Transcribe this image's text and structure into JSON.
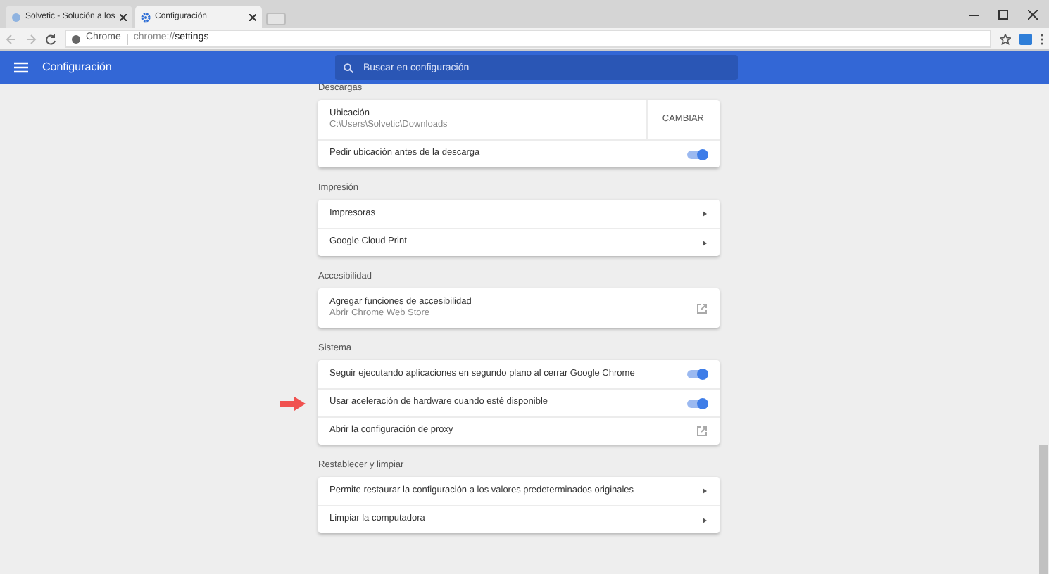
{
  "tabs": [
    {
      "label": "Solvetic - Solución a los",
      "selected": false
    },
    {
      "label": "Configuración",
      "selected": true
    }
  ],
  "address_bar": {
    "site": "Chrome",
    "url_prefix": "chrome://",
    "url_path": "settings"
  },
  "header": {
    "title": "Configuración",
    "search": {
      "placeholder": "Buscar en configuración"
    }
  },
  "sections": [
    {
      "title": "Descargas",
      "rows": [
        {
          "kind": "button",
          "label": "Ubicación",
          "secondary": "C:\\Users\\Solvetic\\Downloads",
          "action": "CAMBIAR"
        },
        {
          "kind": "toggle",
          "label": "Pedir ubicación antes de la descarga",
          "on": true
        }
      ]
    },
    {
      "title": "Impresión",
      "rows": [
        {
          "kind": "arrow",
          "label": "Impresoras"
        },
        {
          "kind": "arrow",
          "label": "Google Cloud Print"
        }
      ]
    },
    {
      "title": "Accesibilidad",
      "rows": [
        {
          "kind": "external",
          "label": "Agregar funciones de accesibilidad",
          "secondary": "Abrir Chrome Web Store"
        }
      ]
    },
    {
      "title": "Sistema",
      "rows": [
        {
          "kind": "toggle",
          "label": "Seguir ejecutando aplicaciones en segundo plano al cerrar Google Chrome",
          "on": true
        },
        {
          "kind": "toggle",
          "label": "Usar aceleración de hardware cuando esté disponible",
          "on": true,
          "pointed": true
        },
        {
          "kind": "external",
          "label": "Abrir la configuración de proxy"
        }
      ]
    },
    {
      "title": "Restablecer y limpiar",
      "rows": [
        {
          "kind": "arrow",
          "label": "Permite restaurar la configuración a los valores predeterminados originales"
        },
        {
          "kind": "arrow",
          "label": "Limpiar la computadora"
        }
      ]
    }
  ]
}
